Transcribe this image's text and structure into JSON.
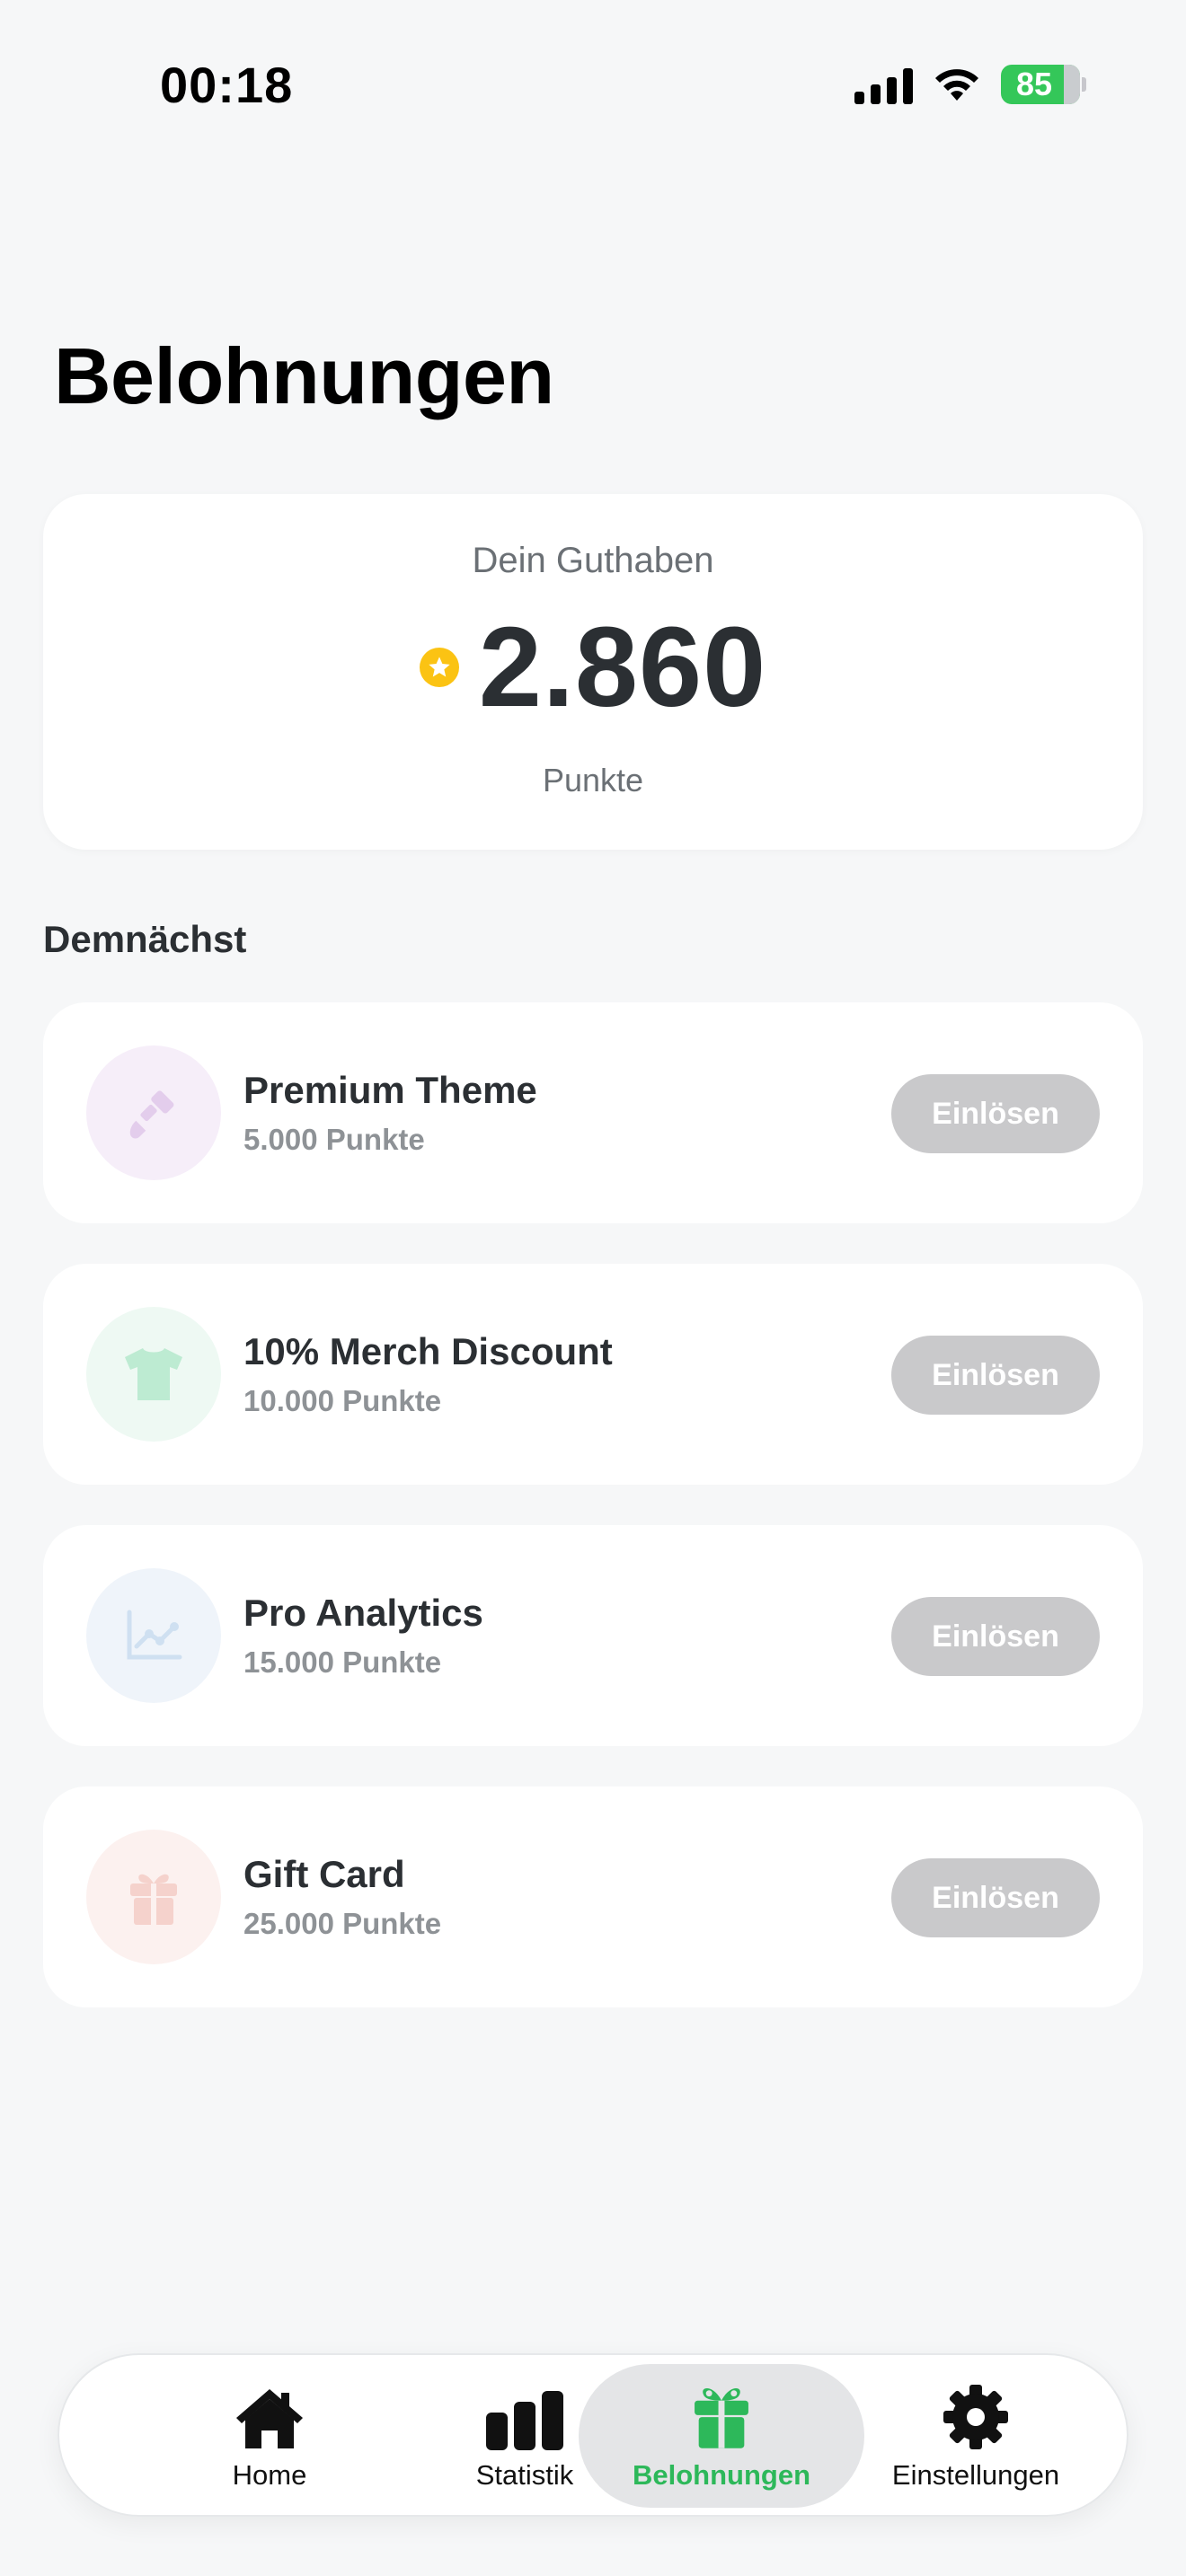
{
  "status_bar": {
    "time": "00:18",
    "battery_percent": "85",
    "icons": [
      "signal-icon",
      "wifi-icon",
      "battery-charging-icon"
    ]
  },
  "page": {
    "title": "Belohnungen"
  },
  "balance": {
    "label": "Dein Guthaben",
    "value": "2.860",
    "unit": "Punkte",
    "icon": "star-coin-icon",
    "icon_color": "#FBC313"
  },
  "section": {
    "title": "Demnächst"
  },
  "rewards": [
    {
      "name": "Premium Theme",
      "cost": "5.000 Punkte",
      "icon": "paintbrush-icon",
      "icon_bg": "#F6EEF9",
      "icon_color": "#E3CDEC",
      "button": "Einlösen"
    },
    {
      "name": "10% Merch Discount",
      "cost": "10.000 Punkte",
      "icon": "tshirt-icon",
      "icon_bg": "#EEF9F3",
      "icon_color": "#BDEBD2",
      "button": "Einlösen"
    },
    {
      "name": "Pro Analytics",
      "cost": "15.000 Punkte",
      "icon": "line-chart-icon",
      "icon_bg": "#EFF4FA",
      "icon_color": "#CFE0F1",
      "button": "Einlösen"
    },
    {
      "name": "Gift Card",
      "cost": "25.000 Punkte",
      "icon": "gift-icon",
      "icon_bg": "#FCF1EF",
      "icon_color": "#F5D2CC",
      "button": "Einlösen"
    }
  ],
  "tab_bar": {
    "active_color": "#2DB85A",
    "tabs": [
      {
        "label": "Home",
        "icon": "house-icon",
        "active": false
      },
      {
        "label": "Statistik",
        "icon": "bar-chart-icon",
        "active": false
      },
      {
        "label": "Belohnungen",
        "icon": "gift-icon",
        "active": true
      },
      {
        "label": "Einstellungen",
        "icon": "gear-icon",
        "active": false
      }
    ]
  }
}
